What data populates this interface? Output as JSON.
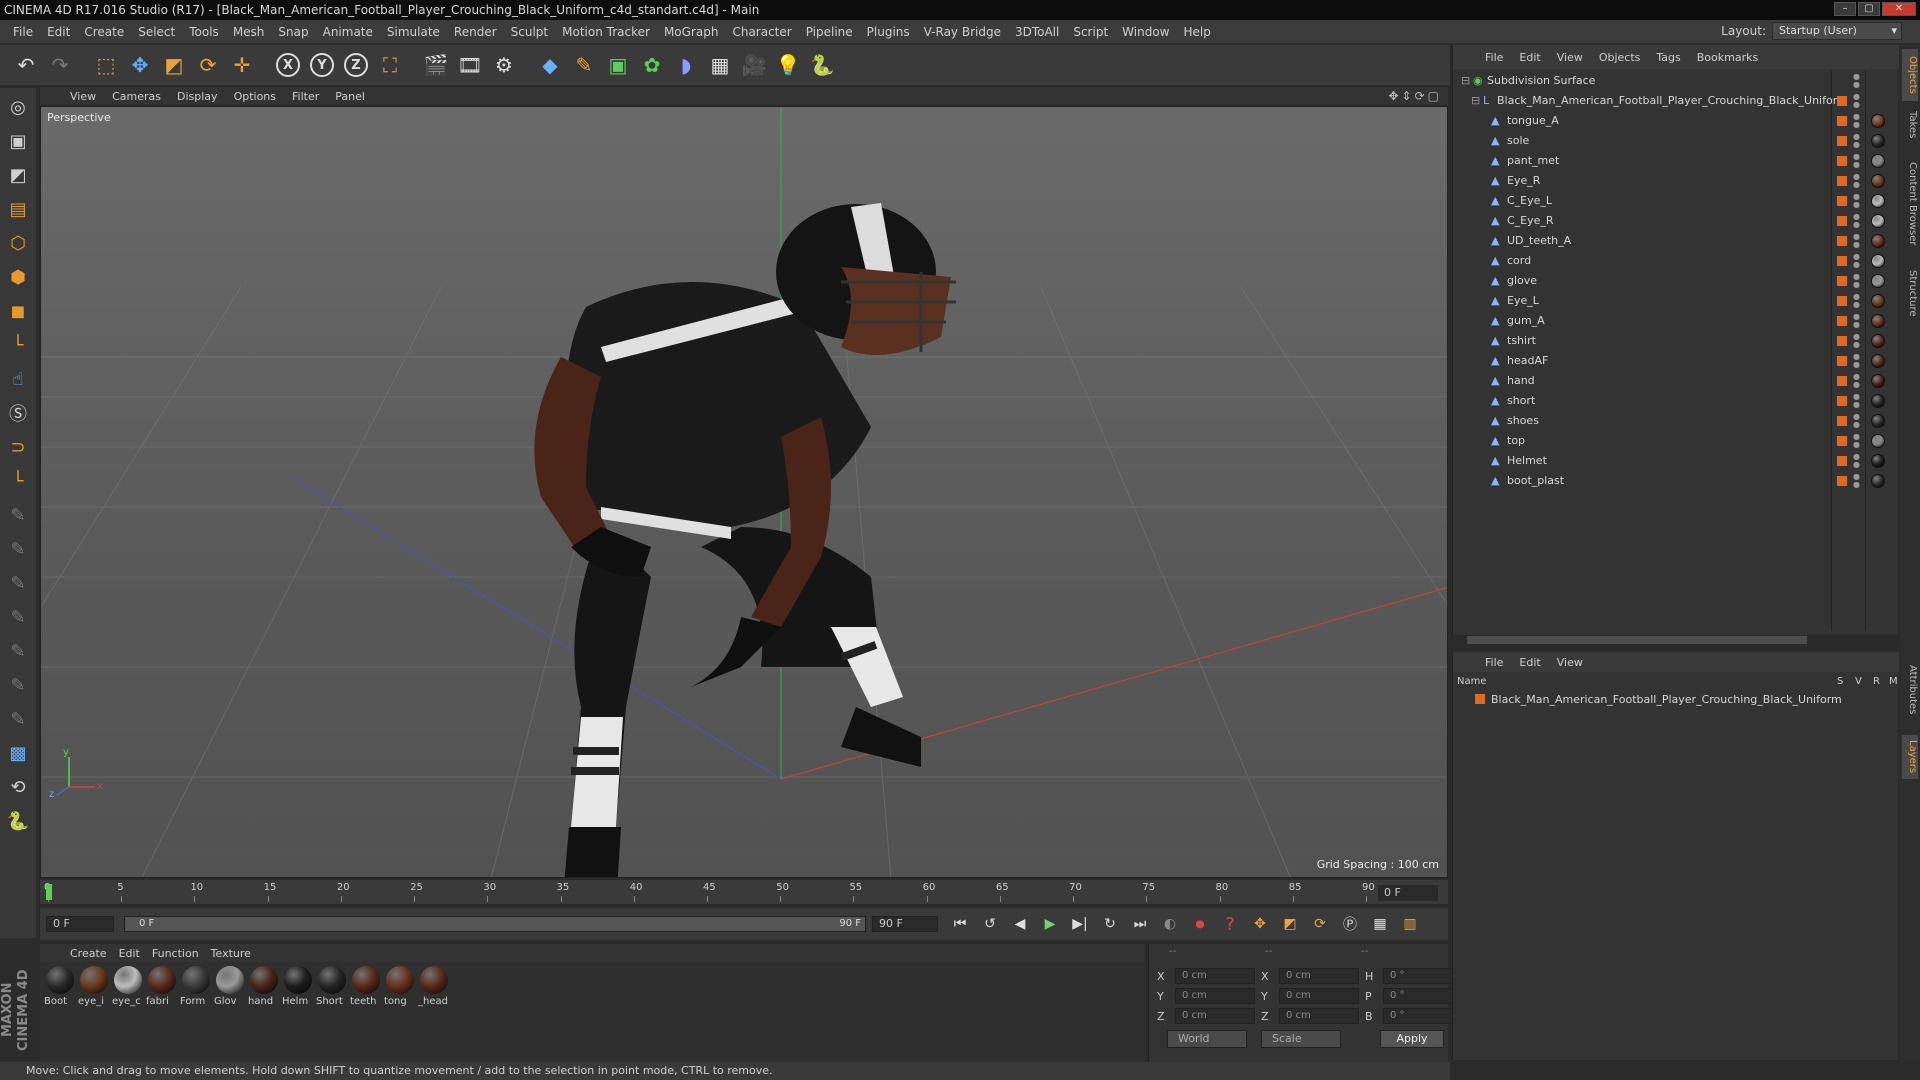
{
  "window": {
    "title": "CINEMA 4D R17.016 Studio (R17) - [Black_Man_American_Football_Player_Crouching_Black_Uniform_c4d_standart.c4d] - Main"
  },
  "menu": [
    "File",
    "Edit",
    "Create",
    "Select",
    "Tools",
    "Mesh",
    "Snap",
    "Animate",
    "Simulate",
    "Render",
    "Sculpt",
    "Motion Tracker",
    "MoGraph",
    "Character",
    "Pipeline",
    "Plugins",
    "V-Ray Bridge",
    "3DToAll",
    "Script",
    "Window",
    "Help"
  ],
  "layout": {
    "label": "Layout:",
    "value": "Startup (User)"
  },
  "toolbar": {
    "x_label": "X",
    "y_label": "Y",
    "z_label": "Z"
  },
  "viewport": {
    "menu": [
      "View",
      "Cameras",
      "Display",
      "Options",
      "Filter",
      "Panel"
    ],
    "label": "Perspective",
    "grid_spacing": "Grid Spacing : 100 cm",
    "axes": {
      "y": "y",
      "z": "z",
      "x": "x"
    }
  },
  "timeline": {
    "ticks": [
      "0",
      "5",
      "10",
      "15",
      "20",
      "25",
      "30",
      "35",
      "40",
      "45",
      "50",
      "55",
      "60",
      "65",
      "70",
      "75",
      "80",
      "85",
      "90"
    ],
    "current_frame_right": "0 F"
  },
  "playback": {
    "start_frame": "0 F",
    "range_start": "0 F",
    "range_end": "90 F",
    "end_frame": "90 F"
  },
  "materials": {
    "menu": [
      "Create",
      "Edit",
      "Function",
      "Texture"
    ],
    "items": [
      {
        "label": "Boot",
        "color": "#2a2a2a"
      },
      {
        "label": "eye_i",
        "color": "#6a3a1c"
      },
      {
        "label": "eye_c",
        "color": "#bdbdbd"
      },
      {
        "label": "fabri",
        "color": "#5a2a1a"
      },
      {
        "label": "Form",
        "color": "#3a3a3a"
      },
      {
        "label": "Glov",
        "color": "#9a9a9a"
      },
      {
        "label": "hand",
        "color": "#4a2418"
      },
      {
        "label": "Helm",
        "color": "#1e1e1e"
      },
      {
        "label": "Short",
        "color": "#262626"
      },
      {
        "label": "teeth",
        "color": "#5a2a1a"
      },
      {
        "label": "tong",
        "color": "#6a3020"
      },
      {
        "label": "_head",
        "color": "#5a2a1a"
      }
    ]
  },
  "coords": {
    "header": [
      "--",
      "--",
      "--"
    ],
    "rows": [
      {
        "l1": "X",
        "v1": "0 cm",
        "l2": "X",
        "v2": "0 cm",
        "l3": "H",
        "v3": "0 °"
      },
      {
        "l1": "Y",
        "v1": "0 cm",
        "l2": "Y",
        "v2": "0 cm",
        "l3": "P",
        "v3": "0 °"
      },
      {
        "l1": "Z",
        "v1": "0 cm",
        "l2": "Z",
        "v2": "0 cm",
        "l3": "B",
        "v3": "0 °"
      }
    ],
    "world": "World",
    "scale": "Scale",
    "apply": "Apply"
  },
  "status": "Move: Click and drag to move elements. Hold down SHIFT to quantize movement / add to the selection in point mode, CTRL to remove.",
  "objects": {
    "menu": [
      "File",
      "Edit",
      "View",
      "Objects",
      "Tags",
      "Bookmarks"
    ],
    "root": "Subdivision Surface",
    "group": "Black_Man_American_Football_Player_Crouching_Black_Uniform",
    "items": [
      {
        "name": "tongue_A",
        "mat": "#7a3a22"
      },
      {
        "name": "sole",
        "mat": "#2a2a2a"
      },
      {
        "name": "pant_met",
        "mat": "#888888"
      },
      {
        "name": "Eye_R",
        "mat": "#6a3a1c"
      },
      {
        "name": "C_Eye_L",
        "mat": "#bdbdbd"
      },
      {
        "name": "C_Eye_R",
        "mat": "#bdbdbd"
      },
      {
        "name": "UD_teeth_A",
        "mat": "#6a3020"
      },
      {
        "name": "cord",
        "mat": "#bbbbbb"
      },
      {
        "name": "glove",
        "mat": "#9a9a9a"
      },
      {
        "name": "Eye_L",
        "mat": "#6a3a1c"
      },
      {
        "name": "gum_A",
        "mat": "#6a3020"
      },
      {
        "name": "tshirt",
        "mat": "#5a2a1a"
      },
      {
        "name": "headAF",
        "mat": "#5a2a1a"
      },
      {
        "name": "hand",
        "mat": "#4a2418"
      },
      {
        "name": "short",
        "mat": "#262626"
      },
      {
        "name": "shoes",
        "mat": "#2a2a2a"
      },
      {
        "name": "top",
        "mat": "#888888"
      },
      {
        "name": "Helmet",
        "mat": "#1e1e1e"
      },
      {
        "name": "boot_plast",
        "mat": "#2a2a2a"
      }
    ]
  },
  "layers": {
    "menu": [
      "File",
      "Edit",
      "View"
    ],
    "columns": [
      "Name",
      "S",
      "V",
      "R",
      "M"
    ],
    "row": "Black_Man_American_Football_Player_Crouching_Black_Uniform"
  },
  "side_tabs": [
    "Objects",
    "Takes",
    "Content Browser",
    "Structure",
    "Attributes",
    "Layers"
  ],
  "logo": {
    "line1": "MAXON",
    "line2": "CINEMA 4D"
  }
}
